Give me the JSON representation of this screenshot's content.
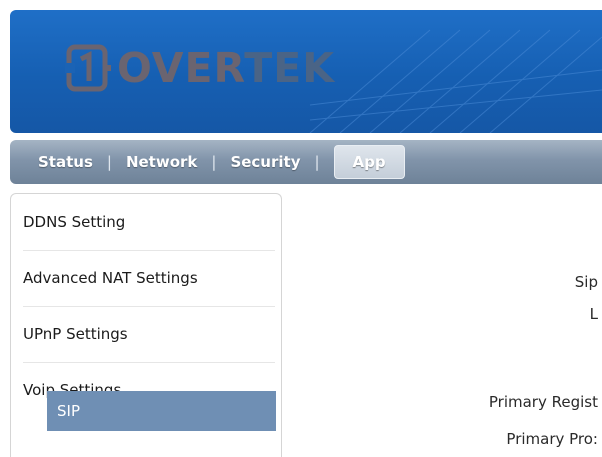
{
  "header": {
    "logo_text_part1": "OVER",
    "logo_text_part2": "TEK",
    "brand_color": "#1a64b8"
  },
  "nav": {
    "items": [
      {
        "label": "Status"
      },
      {
        "label": "Network"
      },
      {
        "label": "Security"
      },
      {
        "label": "App",
        "active": true
      }
    ],
    "separator": "|"
  },
  "sidebar": {
    "items": [
      {
        "label": "DDNS Setting"
      },
      {
        "label": "Advanced NAT Settings"
      },
      {
        "label": "UPnP Settings"
      },
      {
        "label": "Voip Settings"
      }
    ],
    "sub_items": [
      {
        "label": "SIP",
        "selected": true
      }
    ],
    "selected_color": "#6f8fb4"
  },
  "form": {
    "labels": [
      "Sip",
      "L",
      "Primary Regist",
      "Primary Pro:"
    ]
  }
}
